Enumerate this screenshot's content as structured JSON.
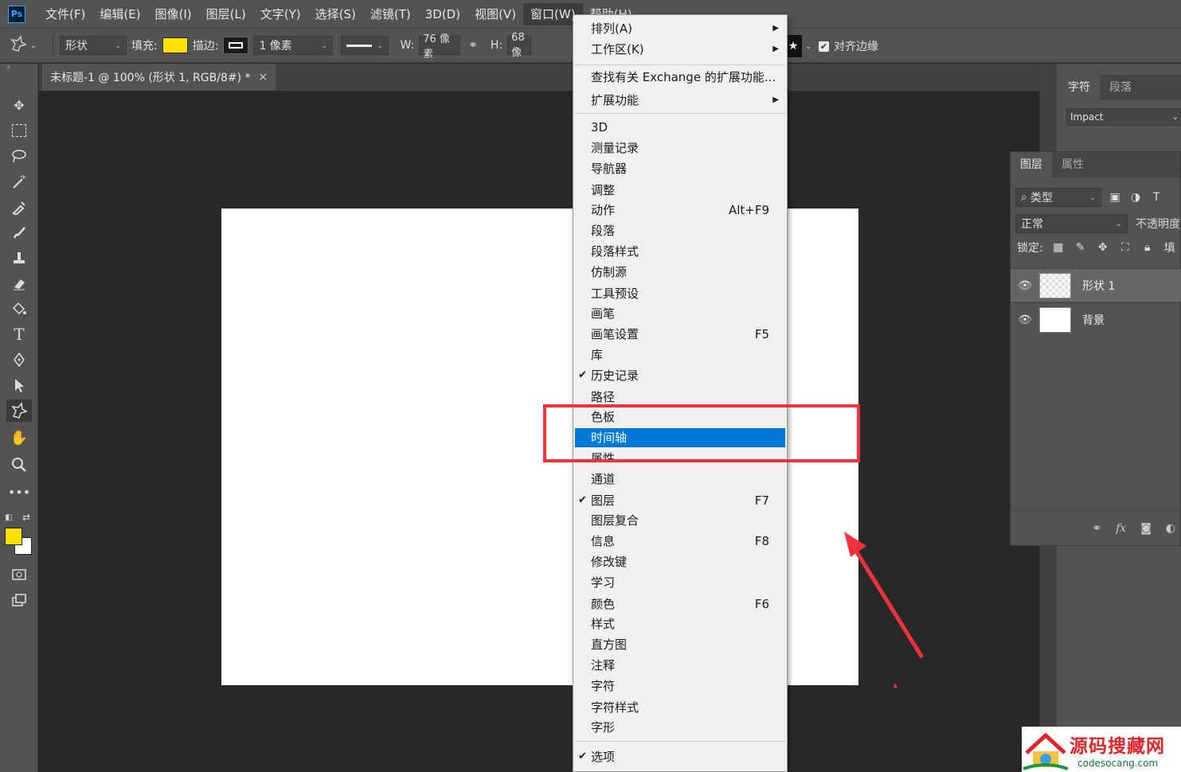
{
  "menubar": {
    "logo": "Ps",
    "items": [
      "文件(F)",
      "编辑(E)",
      "图像(I)",
      "图层(L)",
      "文字(Y)",
      "选择(S)",
      "滤镜(T)",
      "3D(D)",
      "视图(V)",
      "窗口(W)",
      "帮助(H)"
    ],
    "active_index": 9
  },
  "options": {
    "mode": "形状",
    "fill_label": "填充:",
    "stroke_label": "描边:",
    "stroke_width": "1 像素",
    "w_label": "W:",
    "w_value": "76 像素",
    "h_label": "H:",
    "h_value": "68 像",
    "align_edges_label": "对齐边缘",
    "fill_color": "#ffe000"
  },
  "doc_tab": {
    "title": "未标题-1 @ 100% (形状 1, RGB/8#) *",
    "close": "×"
  },
  "character_panel": {
    "tabs": [
      "字符",
      "段落"
    ],
    "font": "Impact"
  },
  "layers_panel": {
    "tabs": [
      "图层",
      "属性"
    ],
    "filter": "类型",
    "blend_mode": "正常",
    "opacity_label": "不透明度",
    "lock_label": "锁定:",
    "fill_label": "填",
    "layers": [
      {
        "name": "形状 1",
        "selected": true
      },
      {
        "name": "背景",
        "selected": false
      }
    ]
  },
  "window_menu": {
    "items": [
      {
        "label": "排列(A)",
        "submenu": true
      },
      {
        "label": "工作区(K)",
        "submenu": true
      },
      {
        "label": "查找有关 Exchange 的扩展功能..."
      },
      {
        "label": "扩展功能",
        "submenu": true
      },
      {
        "label": "3D"
      },
      {
        "label": "测量记录"
      },
      {
        "label": "导航器"
      },
      {
        "label": "调整"
      },
      {
        "label": "动作",
        "shortcut": "Alt+F9"
      },
      {
        "label": "段落"
      },
      {
        "label": "段落样式"
      },
      {
        "label": "仿制源"
      },
      {
        "label": "工具预设"
      },
      {
        "label": "画笔"
      },
      {
        "label": "画笔设置",
        "shortcut": "F5"
      },
      {
        "label": "库"
      },
      {
        "label": "历史记录",
        "checked": true
      },
      {
        "label": "路径"
      },
      {
        "label": "色板"
      },
      {
        "label": "时间轴",
        "highlighted": true
      },
      {
        "label": "属性"
      },
      {
        "label": "通道"
      },
      {
        "label": "图层",
        "shortcut": "F7",
        "checked": true
      },
      {
        "label": "图层复合"
      },
      {
        "label": "信息",
        "shortcut": "F8"
      },
      {
        "label": "修改键"
      },
      {
        "label": "学习"
      },
      {
        "label": "颜色",
        "shortcut": "F6"
      },
      {
        "label": "样式"
      },
      {
        "label": "直方图"
      },
      {
        "label": "注释"
      },
      {
        "label": "字符"
      },
      {
        "label": "字符样式"
      },
      {
        "label": "字形"
      },
      {
        "label": "选项",
        "checked": true
      }
    ]
  },
  "watermark": {
    "name": "源码搜藏网",
    "url": "codesocang.com"
  },
  "colors": {
    "highlight": "#0078d7",
    "annotation": "#f0323c",
    "fg": "#ffe000",
    "bg": "#ffffff"
  }
}
